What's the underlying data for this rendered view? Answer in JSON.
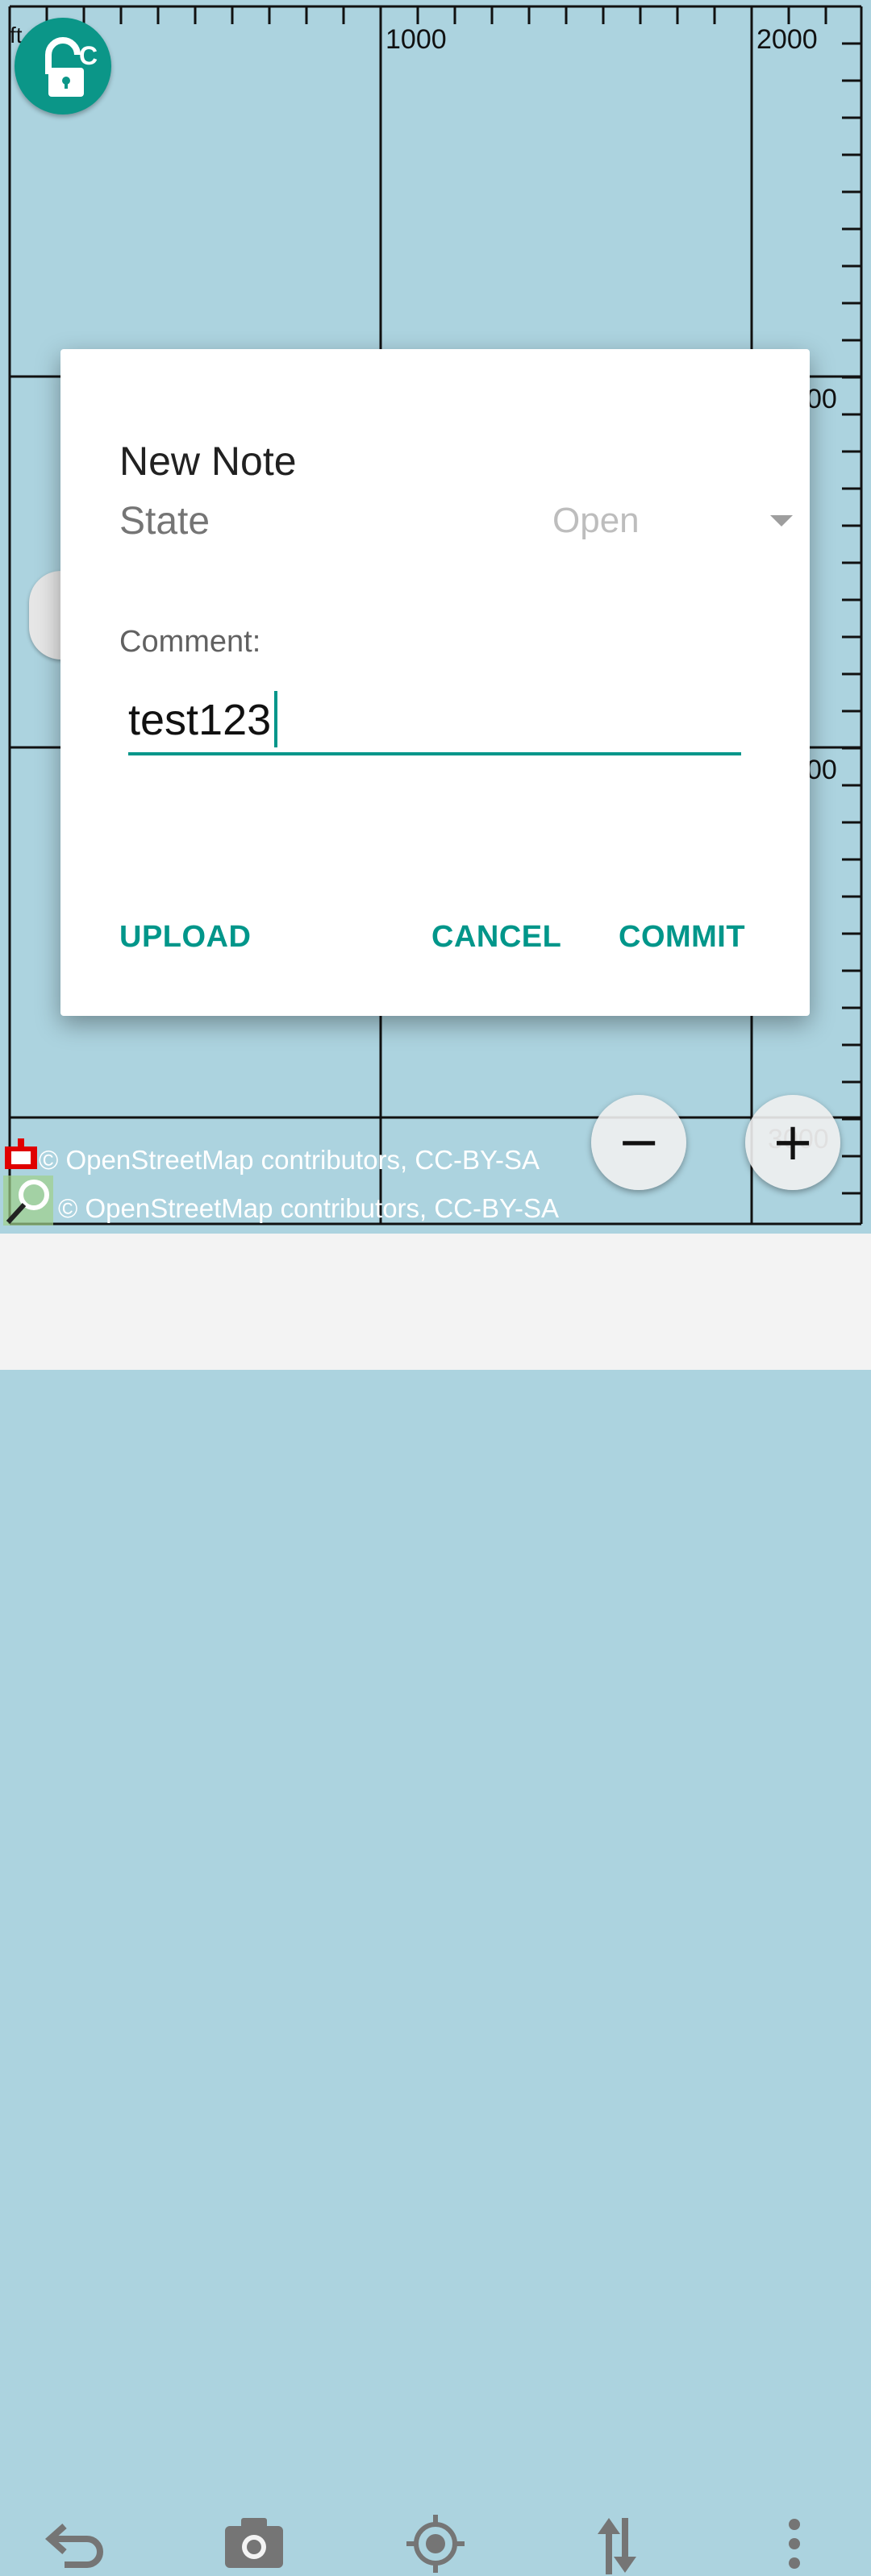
{
  "map": {
    "scale_unit": "ft",
    "scale_labels_top": [
      "1000",
      "2000"
    ],
    "scale_labels_right": [
      "00",
      "00"
    ],
    "scale_label_bottom_right": "3000",
    "attribution_1": "© OpenStreetMap contributors, CC-BY-SA",
    "attribution_2": "© OpenStreetMap contributors, CC-BY-SA",
    "zoom_out_label": "−",
    "zoom_in_label": "+",
    "lock_letter": "C"
  },
  "dialog": {
    "title": "New Note",
    "state_label": "State",
    "state_value": "Open",
    "comment_label": "Comment:",
    "comment_value": "test123",
    "buttons": {
      "upload": "UPLOAD",
      "cancel": "CANCEL",
      "commit": "COMMIT"
    }
  },
  "toolbar": {
    "icons": [
      "undo-icon",
      "camera-icon",
      "gps-icon",
      "transfer-icon",
      "more-vert-icon"
    ]
  },
  "colors": {
    "accent": "#00968a",
    "map_water": "#acd3df",
    "lock_button": "#0b9688"
  }
}
